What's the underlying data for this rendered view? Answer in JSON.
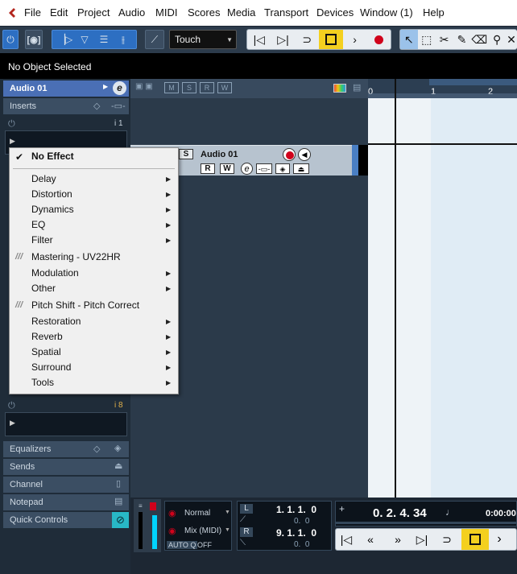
{
  "menubar": {
    "items": [
      "File",
      "Edit",
      "Project",
      "Audio",
      "MIDI",
      "Scores",
      "Media",
      "Transport",
      "Devices",
      "Window (1)",
      "Help"
    ]
  },
  "toolbar": {
    "automation_mode": "Touch"
  },
  "status": {
    "text": "No Object Selected"
  },
  "inspector": {
    "track_name": "Audio 01",
    "edit_icon": "e",
    "inserts_label": "Inserts",
    "slot_top_badge": "i 1",
    "slot_bottom_badge": "i 8",
    "sections": [
      "Equalizers",
      "Sends",
      "Channel",
      "Notepad",
      "Quick Controls"
    ]
  },
  "tracklist": {
    "header_buttons": [
      "M",
      "S",
      "R",
      "W"
    ],
    "track": {
      "solo": "S",
      "name": "Audio 01",
      "read": "R",
      "write": "W",
      "edit": "e"
    }
  },
  "ruler": {
    "marks": [
      "0",
      "1",
      "2"
    ]
  },
  "effects_menu": {
    "header": "No Effect",
    "items": [
      {
        "label": "Delay",
        "submenu": true,
        "plugin": false
      },
      {
        "label": "Distortion",
        "submenu": true,
        "plugin": false
      },
      {
        "label": "Dynamics",
        "submenu": true,
        "plugin": false
      },
      {
        "label": "EQ",
        "submenu": true,
        "plugin": false
      },
      {
        "label": "Filter",
        "submenu": true,
        "plugin": false
      },
      {
        "label": "Mastering - UV22HR",
        "submenu": false,
        "plugin": true
      },
      {
        "label": "Modulation",
        "submenu": true,
        "plugin": false
      },
      {
        "label": "Other",
        "submenu": true,
        "plugin": false
      },
      {
        "label": "Pitch Shift - Pitch Correct",
        "submenu": false,
        "plugin": true
      },
      {
        "label": "Restoration",
        "submenu": true,
        "plugin": false
      },
      {
        "label": "Reverb",
        "submenu": true,
        "plugin": false
      },
      {
        "label": "Spatial",
        "submenu": true,
        "plugin": false
      },
      {
        "label": "Surround",
        "submenu": true,
        "plugin": false
      },
      {
        "label": "Tools",
        "submenu": true,
        "plugin": false
      }
    ]
  },
  "transport": {
    "mode_normal": "Normal",
    "mode_mix": "Mix (MIDI)",
    "autoq_label": "AUTO Q",
    "autoq_value": "OFF",
    "left_locator": "1. 1. 1.  0",
    "left_locator_sub": "0.  0",
    "right_locator": "9. 1. 1.  0",
    "right_locator_sub": "0.  0",
    "L_label": "L",
    "R_label": "R",
    "position": "0. 2. 4. 34",
    "time": "0:00:00"
  },
  "colors": {
    "accent_cyan": "#00d4ff",
    "record_red": "#d0021b",
    "inspector_selected": "#4a6fb5"
  }
}
